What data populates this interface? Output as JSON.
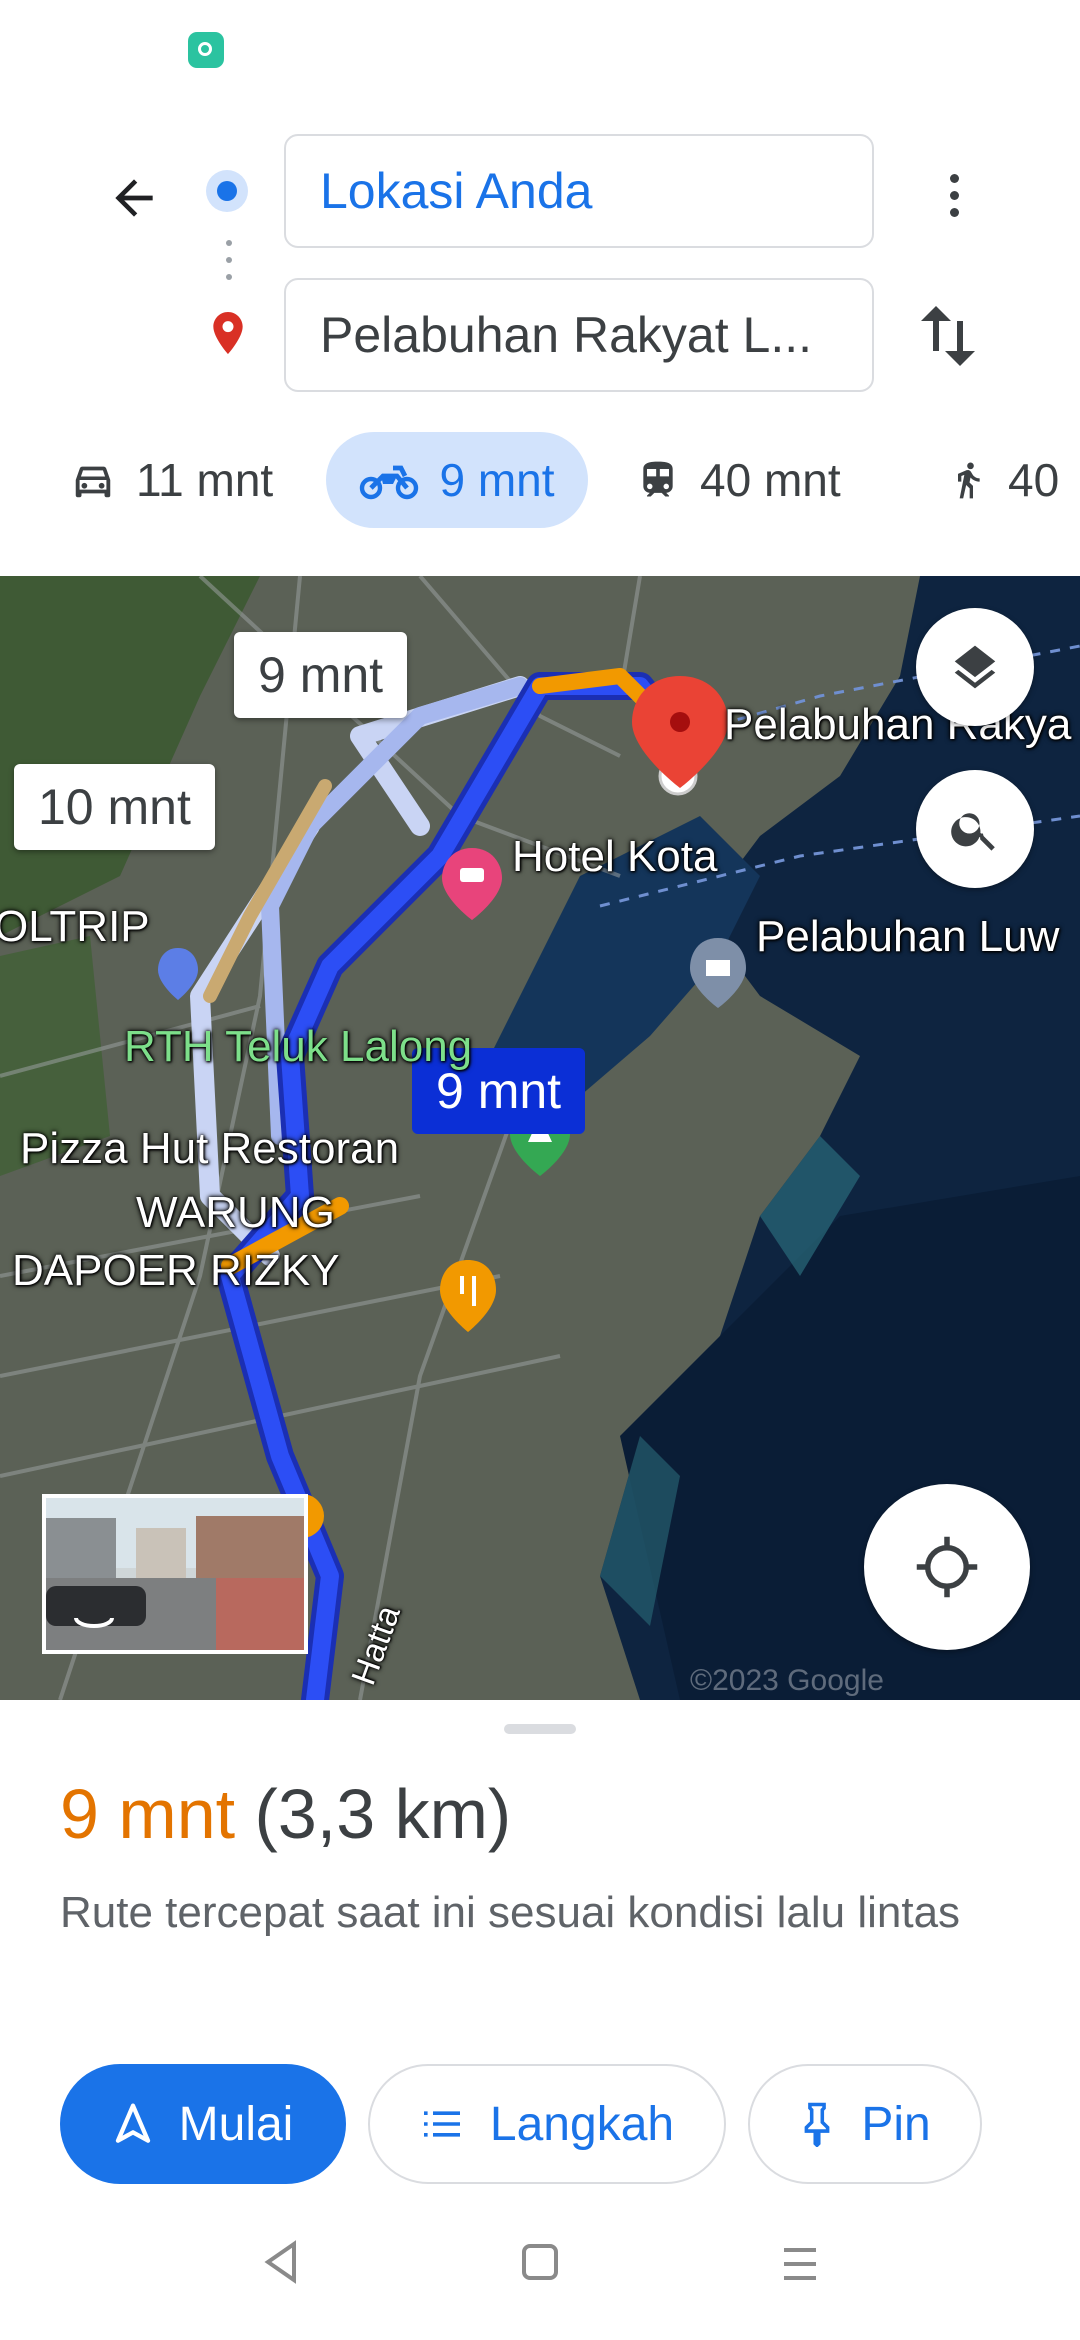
{
  "header": {
    "origin_value": "Lokasi Anda",
    "destination_value": "Pelabuhan Rakyat L..."
  },
  "modes": [
    {
      "name": "car",
      "time": "11 mnt",
      "selected": false
    },
    {
      "name": "motorcycle",
      "time": "9 mnt",
      "selected": true
    },
    {
      "name": "transit",
      "time": "40 mnt",
      "selected": false
    },
    {
      "name": "walk",
      "time": "40",
      "selected": false
    }
  ],
  "map": {
    "callouts": {
      "alt1": "9 mnt",
      "alt2": "10 mnt",
      "selected": "9 mnt"
    },
    "labels": {
      "dest": "Pelabuhan Rakya",
      "hotel": "Hotel Kota",
      "port": "Pelabuhan Luw",
      "park": "RTH Teluk Lalong",
      "pizza": "Pizza Hut Restoran",
      "warung1": "WARUNG",
      "warung2": "DAPOER RIZKY",
      "oltrip": "OLTRIP",
      "road": "Hatta"
    },
    "copyright": "©2023 Google"
  },
  "sheet": {
    "time": "9 mnt",
    "distance": "(3,3 km)",
    "description": "Rute tercepat saat ini sesuai kondisi lalu lintas",
    "start_label": "Mulai",
    "steps_label": "Langkah",
    "pin_label": "Pin"
  },
  "colors": {
    "accent": "#1a73e8",
    "route": "#1a3cf0",
    "traffic": "#f29900",
    "time": "#e37400"
  }
}
